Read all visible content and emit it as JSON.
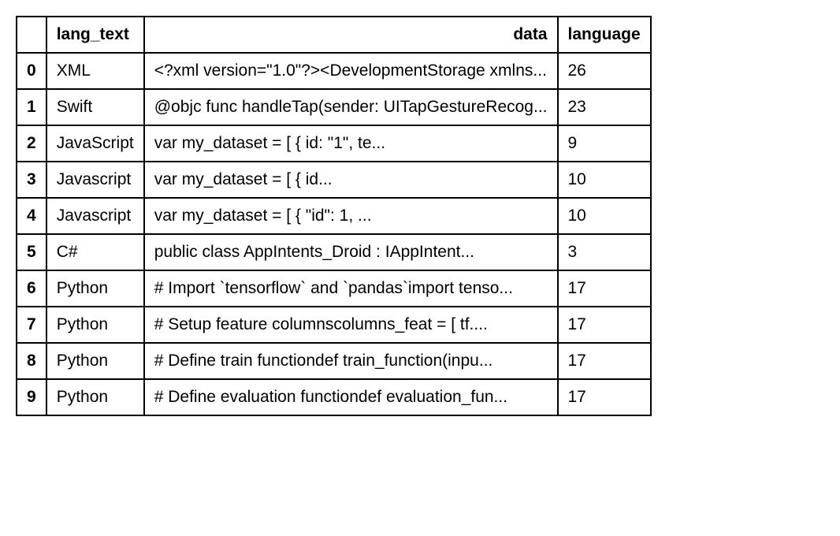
{
  "table": {
    "headers": {
      "index": "",
      "lang_text": "lang_text",
      "data": "data",
      "language": "language"
    },
    "rows": [
      {
        "idx": "0",
        "lang_text": "XML",
        "data": "<?xml version=\"1.0\"?><DevelopmentStorage xmlns...",
        "language": "26"
      },
      {
        "idx": "1",
        "lang_text": "Swift",
        "data": "@objc func handleTap(sender: UITapGestureRecog...",
        "language": "23"
      },
      {
        "idx": "2",
        "lang_text": "JavaScript",
        "data": "var my_dataset = [ { id: \"1\", te...",
        "language": "9"
      },
      {
        "idx": "3",
        "lang_text": "Javascript",
        "data": "var my_dataset = [        {            id...",
        "language": "10"
      },
      {
        "idx": "4",
        "lang_text": "Javascript",
        "data": "var my_dataset = [ { \"id\": 1, ...",
        "language": "10"
      },
      {
        "idx": "5",
        "lang_text": "C#",
        "data": "public class AppIntents_Droid : IAppIntent...",
        "language": "3"
      },
      {
        "idx": "6",
        "lang_text": "Python",
        "data": "# Import `tensorflow` and `pandas`import tenso...",
        "language": "17"
      },
      {
        "idx": "7",
        "lang_text": "Python",
        "data": "# Setup feature columnscolumns_feat = [    tf....",
        "language": "17"
      },
      {
        "idx": "8",
        "lang_text": "Python",
        "data": "# Define train functiondef train_function(inpu...",
        "language": "17"
      },
      {
        "idx": "9",
        "lang_text": "Python",
        "data": "# Define evaluation functiondef evaluation_fun...",
        "language": "17"
      }
    ]
  }
}
